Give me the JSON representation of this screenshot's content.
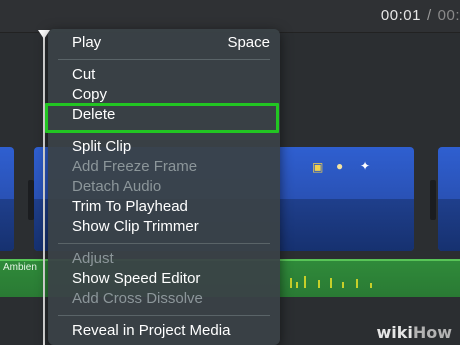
{
  "toolbar": {
    "current_time": "00:01",
    "separator": "/",
    "total_time": "00:"
  },
  "audio_clip": {
    "label": "Ambien"
  },
  "menu": {
    "play": {
      "label": "Play",
      "shortcut": "Space"
    },
    "cut": "Cut",
    "copy": "Copy",
    "delete": "Delete",
    "split_clip": "Split Clip",
    "add_freeze_frame": "Add Freeze Frame",
    "detach_audio": "Detach Audio",
    "trim_to_playhead": "Trim To Playhead",
    "show_clip_trimmer": "Show Clip Trimmer",
    "adjust": "Adjust",
    "show_speed_editor": "Show Speed Editor",
    "add_cross_dissolve": "Add Cross Dissolve",
    "reveal_in_project_media": "Reveal in Project Media"
  },
  "watermark": {
    "wiki": "wiki",
    "how": "How"
  },
  "colors": {
    "highlight": "#22c522",
    "clip_blue": "#2f5fd0",
    "audio_green": "#2f8a3a"
  }
}
